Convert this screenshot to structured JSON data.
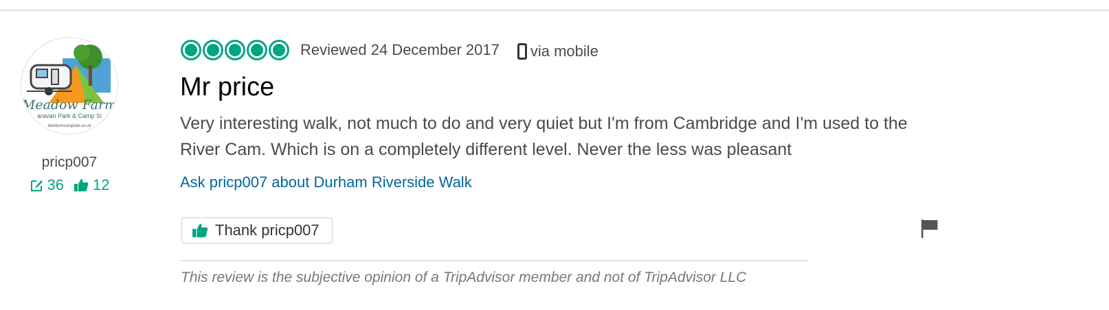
{
  "member": {
    "username": "pricp007",
    "reviews_count": "36",
    "helpful_votes": "12",
    "avatar": {
      "text_line1": "Meadow Farm",
      "text_line2": "aravan Park & Camp Si",
      "text_line3": "dowfarmcampsite.co.uk"
    }
  },
  "review": {
    "rating": 5,
    "reviewed_label": "Reviewed 24 December 2017",
    "via_label": "via mobile",
    "title": "Mr price",
    "body": "Very interesting walk, not much to do and very quiet but I'm from Cambridge and I'm used to the River Cam. Which is on a completely different level. Never the less was pleasant",
    "ask_link": "Ask pricp007 about Durham Riverside Walk",
    "thank_label": "Thank pricp007"
  },
  "disclaimer": "This review is the subjective opinion of a TripAdvisor member and not of TripAdvisor LLC",
  "colors": {
    "accent": "#00a680",
    "link": "#006699"
  },
  "icons": {
    "reviews": "edit-icon",
    "votes": "thumbs-up-icon",
    "device": "mobile-phone-icon",
    "report": "flag-icon"
  }
}
